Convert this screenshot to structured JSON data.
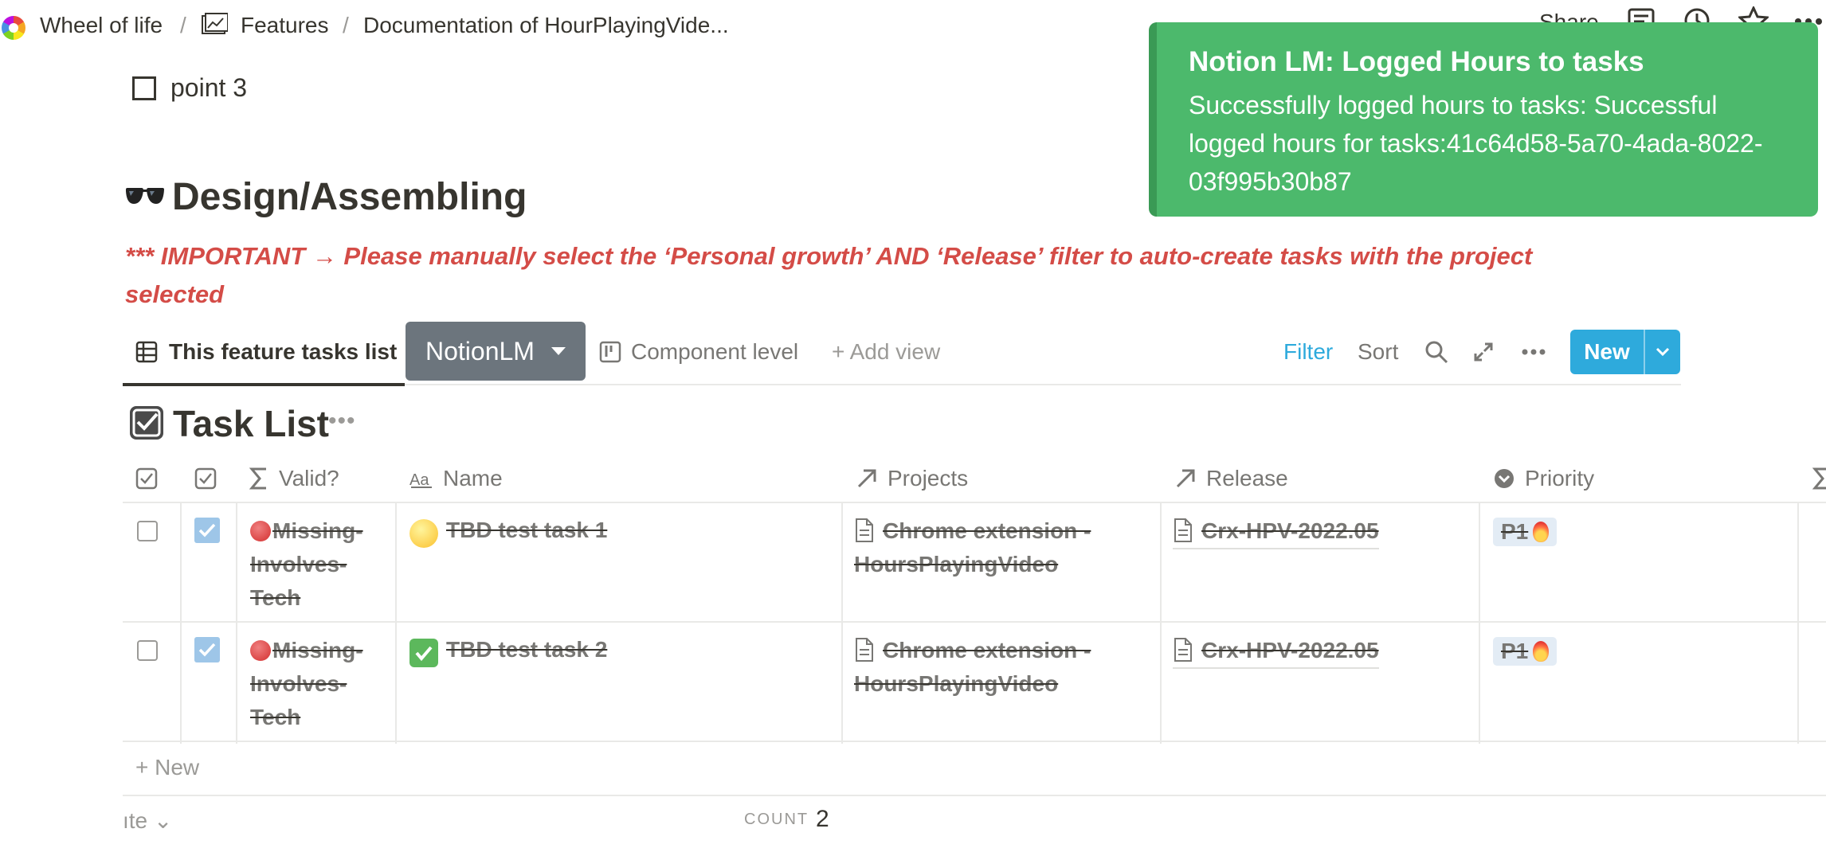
{
  "breadcrumb": {
    "workspace": "Wheel of life",
    "parent": "Features",
    "current": "Documentation of HourPlayingVide..."
  },
  "topbar": {
    "share_label": "Share"
  },
  "todo": {
    "label": "point 3"
  },
  "section": {
    "title": "Design/Assembling",
    "warning": "*** IMPORTANT → Please manually select the ‘Personal growth’ AND ‘Release’ filter to auto-create tasks with the project selected"
  },
  "views": {
    "active": "This feature tasks list",
    "dropdown_label": "NotionLM",
    "other": "Component level",
    "add": "+ Add view",
    "filter": "Filter",
    "sort": "Sort",
    "new": "New"
  },
  "database": {
    "title": "Task List"
  },
  "table": {
    "headers": {
      "valid": "Valid?",
      "name": "Name",
      "projects": "Projects",
      "release": "Release",
      "priority": "Priority"
    },
    "rows": [
      {
        "valid": "Missing-Involves-Tech",
        "name": "TBD test task 1",
        "name_icon": "yellow-circle-icon",
        "project": "Chrome extension - HoursPlayingVideo",
        "release": "Crx-HPV-2022.05",
        "priority": "P1"
      },
      {
        "valid": "Missing-Involves-Tech",
        "name": "TBD test task 2",
        "name_icon": "green-check-icon",
        "project": "Chrome extension - HoursPlayingVideo",
        "release": "Crx-HPV-2022.05",
        "priority": "P1"
      }
    ],
    "add_new": "+ New",
    "calc_label": "ıte ⌄",
    "count_label": "COUNT",
    "count_value": "2"
  },
  "toast": {
    "title": "Notion LM: Logged Hours to tasks",
    "body": "Successfully logged hours to tasks: Successful logged hours for tasks:41c64d58-5a70-4ada-8022-03f995b30b87"
  },
  "colors": {
    "accent": "#2eaadc",
    "toast_bg": "#4cb96c",
    "warning": "#d44c47",
    "dropdown_bg": "#6c757d"
  }
}
